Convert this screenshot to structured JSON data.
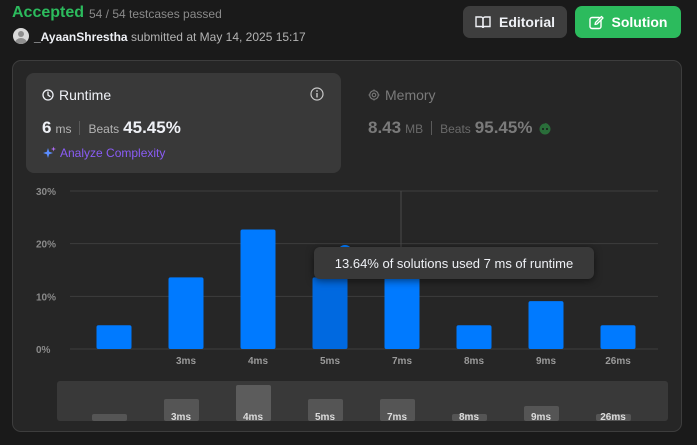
{
  "header": {
    "status": "Accepted",
    "testcases": "54 / 54 testcases passed",
    "username": "_AyaanShrestha",
    "submitted_text": "submitted at May 14, 2025 15:17",
    "editorial_label": "Editorial",
    "solution_label": "Solution"
  },
  "runtime": {
    "title": "Runtime",
    "value": "6",
    "unit": "ms",
    "beats_label": "Beats",
    "beats_value": "45.45%",
    "analyze_label": "Analyze Complexity"
  },
  "memory": {
    "title": "Memory",
    "value": "8.43",
    "unit": "MB",
    "beats_label": "Beats",
    "beats_value": "95.45%"
  },
  "tooltip": {
    "text": "13.64% of solutions used 7 ms of runtime"
  },
  "colors": {
    "accepted": "#2cbb5d",
    "bar": "#007aff",
    "bar_highlight": "#0069e0",
    "analyze": "#8a5cf5"
  },
  "chart_data": {
    "type": "bar",
    "categories": [
      "",
      "3ms",
      "4ms",
      "5ms",
      "7ms",
      "8ms",
      "9ms",
      "26ms"
    ],
    "values": [
      4.5,
      13.6,
      22.7,
      13.6,
      13.6,
      4.5,
      9.1,
      4.5
    ],
    "y_ticks": [
      "0%",
      "10%",
      "20%",
      "30%"
    ],
    "ylim": [
      0,
      30
    ],
    "highlight_index": 3,
    "grid": true,
    "overview_labels": [
      "",
      "3ms",
      "4ms",
      "5ms",
      "7ms",
      "8ms",
      "9ms",
      "26ms"
    ]
  }
}
